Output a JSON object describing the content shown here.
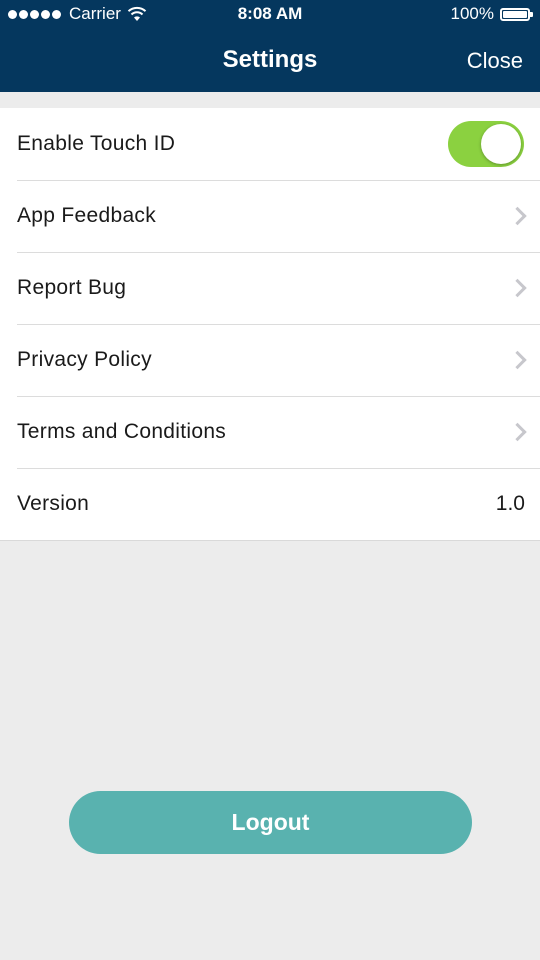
{
  "status_bar": {
    "carrier": "Carrier",
    "time": "8:08 AM",
    "battery": "100%",
    "icons": [
      "signal-icon",
      "wifi-icon",
      "battery-icon"
    ]
  },
  "nav": {
    "title": "Settings",
    "close_label": "Close"
  },
  "settings": {
    "touch_id": {
      "label": "Enable Touch ID",
      "enabled": true
    },
    "app_feedback": {
      "label": "App Feedback"
    },
    "report_bug": {
      "label": "Report Bug"
    },
    "privacy_policy": {
      "label": "Privacy Policy"
    },
    "terms": {
      "label": "Terms and Conditions"
    },
    "version": {
      "label": "Version",
      "value": "1.0"
    }
  },
  "logout": {
    "label": "Logout"
  },
  "colors": {
    "nav_background": "#05375e",
    "toggle_on": "#8bd140",
    "logout_button": "#59b2af",
    "page_background": "#ececec"
  }
}
